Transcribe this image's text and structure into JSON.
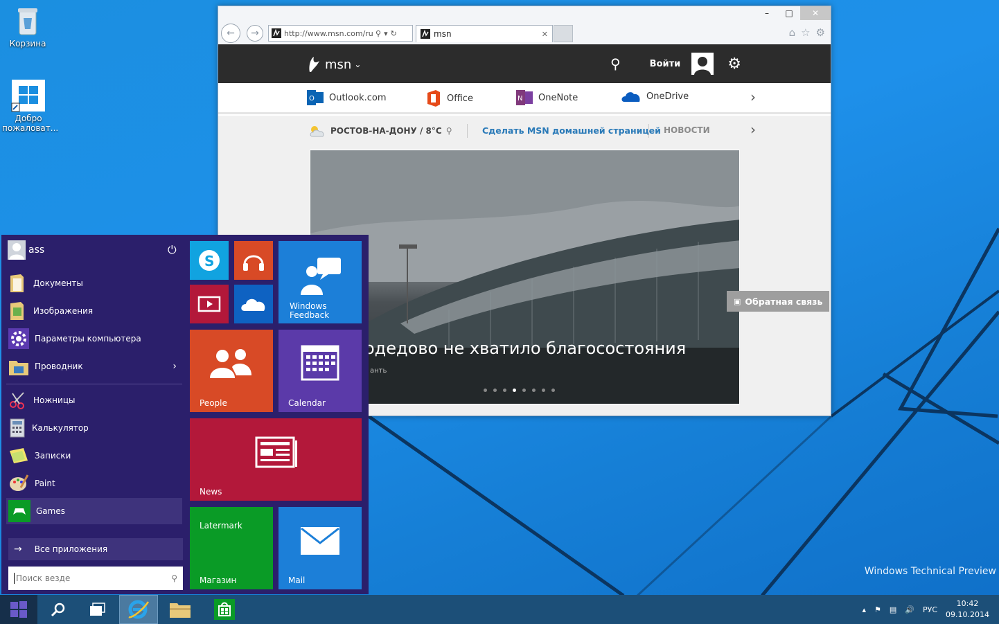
{
  "desktop": {
    "icons": [
      {
        "label": "Корзина",
        "icon": "recycle-bin-icon"
      },
      {
        "label": "Добро пожаловат...",
        "icon": "windows-logo-icon"
      }
    ],
    "watermark": "Windows Technical Preview"
  },
  "browser": {
    "address": "http://www.msn.com/ru",
    "tab_title": "msn",
    "msn": {
      "logo": "msn",
      "signin": "Войти",
      "apps": [
        "Outlook.com",
        "Office",
        "OneNote",
        "OneDrive"
      ],
      "weather": "РОСТОВ-НА-ДОНУ / 8°C",
      "make_home": "Сделать MSN домашней страницей",
      "news": "НОВОСТИ",
      "hero_title": "одедово не хватило благосостояния",
      "hero_sub": "анть",
      "feedback": "Обратная связь"
    }
  },
  "start_menu": {
    "user": "ass",
    "places": [
      {
        "label": "Документы",
        "icon": "documents-folder-icon"
      },
      {
        "label": "Изображения",
        "icon": "pictures-folder-icon"
      },
      {
        "label": "Параметры компьютера",
        "icon": "settings-gear-icon"
      },
      {
        "label": "Проводник",
        "icon": "file-explorer-icon"
      }
    ],
    "apps": [
      {
        "label": "Ножницы",
        "icon": "scissors-icon"
      },
      {
        "label": "Калькулятор",
        "icon": "calculator-icon"
      },
      {
        "label": "Записки",
        "icon": "sticky-notes-icon"
      },
      {
        "label": "Paint",
        "icon": "paint-palette-icon"
      },
      {
        "label": "Games",
        "icon": "gamepad-icon"
      }
    ],
    "all_apps": "Все приложения",
    "search_placeholder": "Поиск везде",
    "tiles": {
      "feedback": "Windows Feedback",
      "people": "People",
      "calendar": "Calendar",
      "news": "News",
      "store_top": "Latermark",
      "store": "Магазин",
      "mail": "Mail"
    },
    "colors": {
      "bg": "#2b1f6b",
      "skype": "#11a3e0",
      "music": "#d84a26",
      "video": "#b3183a",
      "onedrive": "#0e62c2",
      "feedback": "#1c7fd8",
      "people": "#d84a26",
      "calendar": "#5b3aa9",
      "news": "#b3183a",
      "store": "#0a9b26",
      "mail": "#1c7fd8"
    }
  },
  "taskbar": {
    "language": "РУС",
    "time": "10:42",
    "date": "09.10.2014"
  }
}
